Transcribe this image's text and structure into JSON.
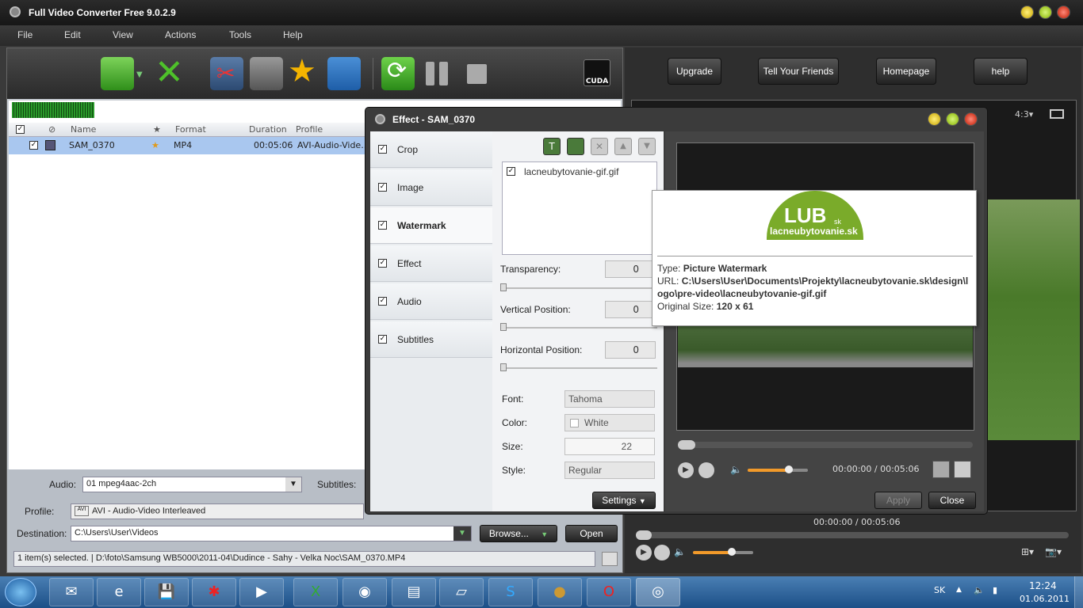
{
  "app": {
    "title": "Full Video Converter Free 9.0.2.9"
  },
  "menu": [
    "File",
    "Edit",
    "View",
    "Actions",
    "Tools",
    "Help"
  ],
  "toolbar": {
    "cuda_label": "CUDA"
  },
  "file_list": {
    "columns": {
      "name": "Name",
      "format": "Format",
      "duration": "Duration",
      "profile": "Profile"
    },
    "rows": [
      {
        "name": "SAM_0370",
        "format": "MP4",
        "duration": "00:05:06",
        "profile": "AVI-Audio-Vide..."
      }
    ]
  },
  "bottom": {
    "audio_label": "Audio:",
    "audio_value": "01 mpeg4aac-2ch",
    "subtitles_label": "Subtitles:",
    "profile_label": "Profile:",
    "profile_value": "AVI - Audio-Video Interleaved",
    "destination_label": "Destination:",
    "destination_value": "C:\\Users\\User\\Videos",
    "browse_label": "Browse...",
    "open_label": "Open",
    "status": "1 item(s) selected. | D:\\foto\\Samsung WB5000\\2011-04\\Dudince - Sahy - Velka Noc\\SAM_0370.MP4"
  },
  "right": {
    "upgrade": "Upgrade",
    "tell_friends": "Tell Your Friends",
    "homepage": "Homepage",
    "help": "help",
    "aspect": "4:3",
    "time": "00:00:00 / 00:05:06"
  },
  "dialog": {
    "title": "Effect - SAM_0370",
    "tabs": [
      "Crop",
      "Image",
      "Watermark",
      "Effect",
      "Audio",
      "Subtitles"
    ],
    "watermark_file": "lacneubytovanie-gif.gif",
    "transparency_label": "Transparency:",
    "transparency_value": "0",
    "vertical_label": "Vertical Position:",
    "vertical_value": "0",
    "horizontal_label": "Horizontal Position:",
    "horizontal_value": "0",
    "font_label": "Font:",
    "font_value": "Tahoma",
    "color_label": "Color:",
    "color_value": "White",
    "size_label": "Size:",
    "size_value": "22",
    "style_label": "Style:",
    "style_value": "Regular",
    "settings_label": "Settings",
    "time": "00:00:00 / 00:05:06",
    "apply_label": "Apply",
    "close_label": "Close"
  },
  "tooltip": {
    "logo_text": "LUB",
    "logo_sk": "sk",
    "logo_sub": "lacneubytovanie.sk",
    "type_label": "Type:",
    "type_value": "Picture Watermark",
    "url_label": "URL:",
    "url_value": "C:\\Users\\User\\Documents\\Projekty\\lacneubytovanie.sk\\design\\logo\\pre-video\\lacneubytovanie-gif.gif",
    "size_label": "Original Size:",
    "size_value": "120 x 61"
  },
  "taskbar": {
    "lang": "SK",
    "time": "12:24",
    "date": "01.06.2011"
  }
}
